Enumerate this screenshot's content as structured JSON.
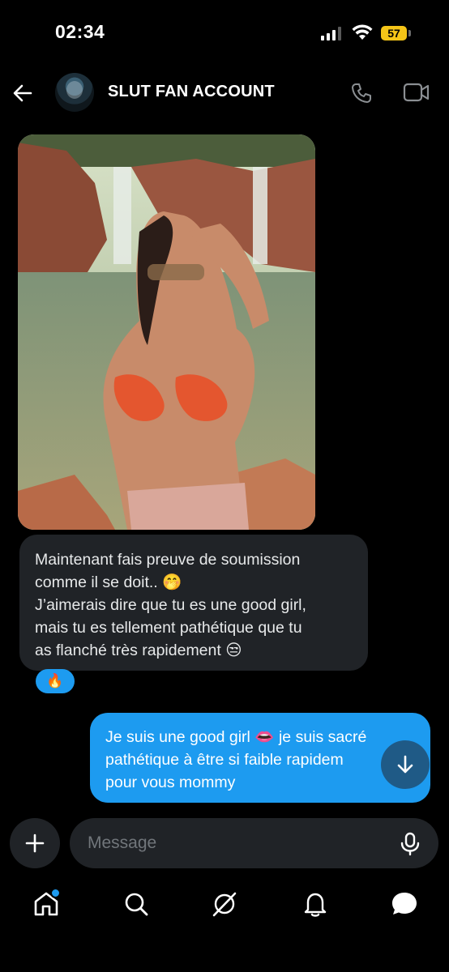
{
  "status_bar": {
    "time": "02:34",
    "battery": "57"
  },
  "header": {
    "contact_name": "SLUT FAN ACCOUNT"
  },
  "messages": {
    "received": {
      "lines": [
        "Maintenant fais preuve de soumission",
        "comme il se doit.. 🤭",
        "J’aimerais dire que tu es une good girl,",
        "mais tu es tellement pathétique que tu",
        "as flanché très rapidement 😒"
      ],
      "reaction": "🔥"
    },
    "sent": {
      "lines": [
        "Je suis une good girl 👄 je suis sacré",
        "pathétique à être si faible rapidem",
        "pour vous mommy"
      ]
    }
  },
  "composer": {
    "placeholder": "Message"
  },
  "nav": {
    "items": [
      "home-icon",
      "search-icon",
      "grok-icon",
      "notifications-icon",
      "messages-icon"
    ]
  },
  "colors": {
    "accent": "#1d9bf0",
    "bubble_received": "#202327",
    "battery": "#f5c518"
  }
}
